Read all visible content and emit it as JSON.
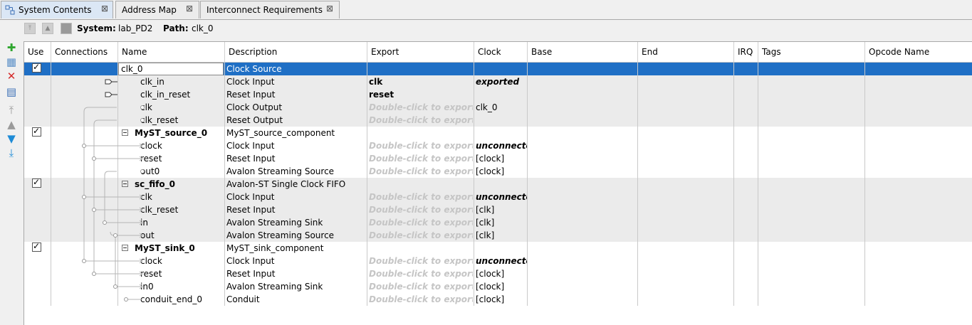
{
  "tabs": [
    {
      "label": "System Contents",
      "close": "⊠",
      "active": true,
      "icon": "system-contents-icon"
    },
    {
      "label": "Address Map",
      "close": "⊠",
      "active": false
    },
    {
      "label": "Interconnect Requirements",
      "close": "⊠",
      "active": false
    }
  ],
  "pathbar": {
    "system_label": "System:",
    "system_value": "lab_PD2",
    "path_label": "Path:",
    "path_value": "clk_0"
  },
  "columns": [
    "Use",
    "Connections",
    "Name",
    "Description",
    "Export",
    "Clock",
    "Base",
    "End",
    "IRQ",
    "Tags",
    "Opcode Name"
  ],
  "rows": [
    {
      "type": "component",
      "selected": true,
      "use": true,
      "name": "clk_0",
      "description": "Clock Source",
      "export": "",
      "clock": ""
    },
    {
      "type": "interface",
      "name": "clk_in",
      "description": "Clock Input",
      "export": "clk",
      "export_style": "bold",
      "clock": "exported",
      "clock_style": "bi",
      "conn": "clk_in"
    },
    {
      "type": "interface",
      "name": "clk_in_reset",
      "description": "Reset Input",
      "export": "reset",
      "export_style": "bold",
      "clock": "",
      "conn": "clk_in_reset"
    },
    {
      "type": "interface",
      "name": "clk",
      "description": "Clock Output",
      "export": "Double-click to export",
      "export_style": "hint",
      "clock": "clk_0"
    },
    {
      "type": "interface",
      "name": "clk_reset",
      "description": "Reset Output",
      "export": "Double-click to export",
      "export_style": "hint",
      "clock": ""
    },
    {
      "type": "component",
      "use": true,
      "name": "MyST_source_0",
      "description": "MyST_source_component",
      "export": "",
      "clock": ""
    },
    {
      "type": "interface",
      "name": "clock",
      "description": "Clock Input",
      "export": "Double-click to export",
      "export_style": "hint",
      "clock": "unconnected",
      "clock_style": "bi"
    },
    {
      "type": "interface",
      "name": "reset",
      "description": "Reset Input",
      "export": "Double-click to export",
      "export_style": "hint",
      "clock": "[clock]"
    },
    {
      "type": "interface",
      "name": "out0",
      "description": "Avalon Streaming Source",
      "export": "Double-click to export",
      "export_style": "hint",
      "clock": "[clock]"
    },
    {
      "type": "component",
      "use": true,
      "name": "sc_fifo_0",
      "description": "Avalon-ST Single Clock FIFO",
      "export": "",
      "clock": ""
    },
    {
      "type": "interface",
      "name": "clk",
      "description": "Clock Input",
      "export": "Double-click to export",
      "export_style": "hint",
      "clock": "unconnected",
      "clock_style": "bi"
    },
    {
      "type": "interface",
      "name": "clk_reset",
      "description": "Reset Input",
      "export": "Double-click to export",
      "export_style": "hint",
      "clock": "[clk]"
    },
    {
      "type": "interface",
      "name": "in",
      "description": "Avalon Streaming Sink",
      "export": "Double-click to export",
      "export_style": "hint",
      "clock": "[clk]"
    },
    {
      "type": "interface",
      "name": "out",
      "description": "Avalon Streaming Source",
      "export": "Double-click to export",
      "export_style": "hint",
      "clock": "[clk]"
    },
    {
      "type": "component",
      "use": true,
      "name": "MyST_sink_0",
      "description": "MyST_sink_component",
      "export": "",
      "clock": ""
    },
    {
      "type": "interface",
      "name": "clock",
      "description": "Clock Input",
      "export": "Double-click to export",
      "export_style": "hint",
      "clock": "unconnected",
      "clock_style": "bi"
    },
    {
      "type": "interface",
      "name": "reset",
      "description": "Reset Input",
      "export": "Double-click to export",
      "export_style": "hint",
      "clock": "[clock]"
    },
    {
      "type": "interface",
      "name": "in0",
      "description": "Avalon Streaming Sink",
      "export": "Double-click to export",
      "export_style": "hint",
      "clock": "[clock]"
    },
    {
      "type": "interface",
      "name": "conduit_end_0",
      "description": "Conduit",
      "export": "Double-click to export",
      "export_style": "hint",
      "clock": "[clock]"
    }
  ],
  "left_tools": [
    {
      "name": "add-component-icon",
      "glyph": "✚",
      "color": "#2fa62f"
    },
    {
      "name": "add-instance-icon",
      "glyph": "▦",
      "color": "#5a8fc7"
    },
    {
      "name": "remove-icon",
      "glyph": "✕",
      "color": "#d42a2a"
    },
    {
      "name": "edit-icon",
      "glyph": "▤",
      "color": "#3b6fb6"
    },
    {
      "name": "move-top-icon",
      "glyph": "⤒",
      "color": "#9a9a9a"
    },
    {
      "name": "move-up-icon",
      "glyph": "▲",
      "color": "#9a9a9a"
    },
    {
      "name": "move-down-icon",
      "glyph": "▼",
      "color": "#1e8bd6"
    },
    {
      "name": "move-bottom-icon",
      "glyph": "⤓",
      "color": "#1e8bd6"
    }
  ]
}
